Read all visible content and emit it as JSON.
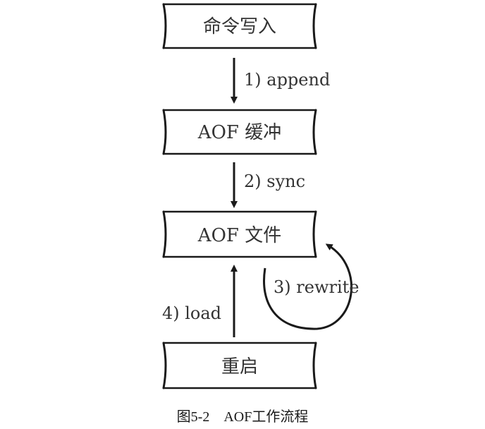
{
  "nodes": {
    "command_write": "命令写入",
    "aof_buffer": "AOF 缓冲",
    "aof_file": "AOF 文件",
    "restart": "重启"
  },
  "edges": {
    "append": "1) append",
    "sync": "2) sync",
    "rewrite": "3) rewrite",
    "load": "4) load"
  },
  "caption": {
    "figure_number": "图5-2",
    "title": "AOF工作流程"
  },
  "colors": {
    "stroke": "#1a1a1a",
    "text": "#333333",
    "background": "#ffffff"
  }
}
